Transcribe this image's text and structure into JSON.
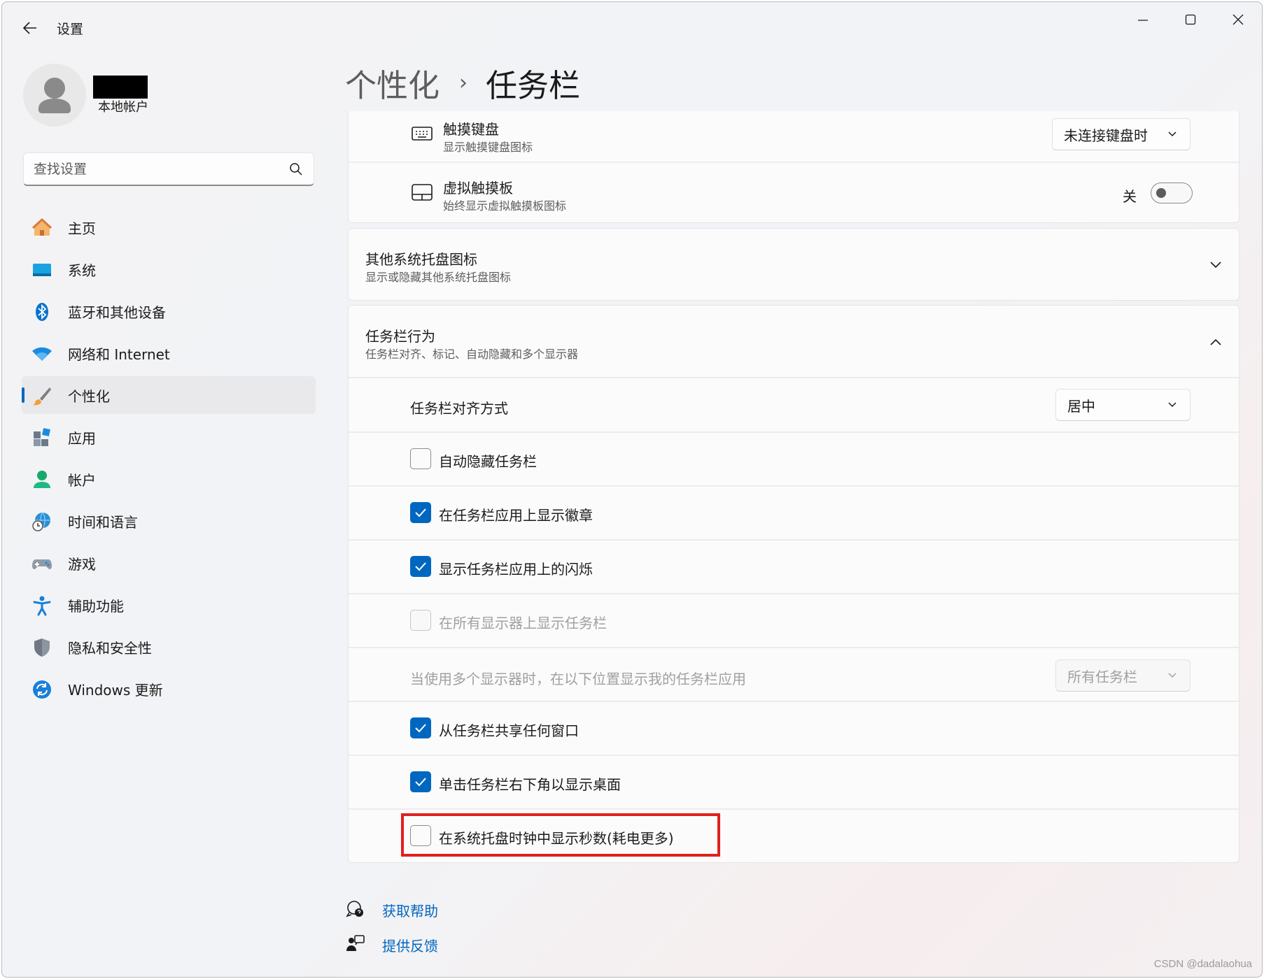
{
  "window": {
    "title": "设置"
  },
  "profile": {
    "account_type": "本地帐户"
  },
  "search": {
    "placeholder": "查找设置"
  },
  "nav": {
    "items": [
      {
        "label": "主页",
        "icon": "home-icon"
      },
      {
        "label": "系统",
        "icon": "system-icon"
      },
      {
        "label": "蓝牙和其他设备",
        "icon": "bluetooth-icon"
      },
      {
        "label": "网络和 Internet",
        "icon": "wifi-icon"
      },
      {
        "label": "个性化",
        "icon": "brush-icon",
        "active": true
      },
      {
        "label": "应用",
        "icon": "apps-icon"
      },
      {
        "label": "帐户",
        "icon": "account-icon"
      },
      {
        "label": "时间和语言",
        "icon": "globe-clock-icon"
      },
      {
        "label": "游戏",
        "icon": "gamepad-icon"
      },
      {
        "label": "辅助功能",
        "icon": "accessibility-icon"
      },
      {
        "label": "隐私和安全性",
        "icon": "shield-icon"
      },
      {
        "label": "Windows 更新",
        "icon": "update-icon"
      }
    ]
  },
  "header": {
    "parent": "个性化",
    "separator": "›",
    "current": "任务栏"
  },
  "tray": {
    "touch_keyboard": {
      "title": "触摸键盘",
      "subtitle": "显示触摸键盘图标",
      "value": "未连接键盘时"
    },
    "virtual_touchpad": {
      "title": "虚拟触摸板",
      "subtitle": "始终显示虚拟触摸板图标",
      "state_label": "关",
      "on": false
    }
  },
  "other_tray": {
    "title": "其他系统托盘图标",
    "subtitle": "显示或隐藏其他系统托盘图标"
  },
  "behaviors": {
    "title": "任务栏行为",
    "subtitle": "任务栏对齐、标记、自动隐藏和多个显示器",
    "alignment": {
      "label": "任务栏对齐方式",
      "value": "居中"
    },
    "options": {
      "auto_hide": {
        "label": "自动隐藏任务栏",
        "checked": false
      },
      "badges": {
        "label": "在任务栏应用上显示徽章",
        "checked": true
      },
      "flashing": {
        "label": "显示任务栏应用上的闪烁",
        "checked": true
      },
      "all_displays": {
        "label": "在所有显示器上显示任务栏",
        "checked": false,
        "disabled": true
      },
      "share_window": {
        "label": "从任务栏共享任何窗口",
        "checked": true
      },
      "show_desktop": {
        "label": "单击任务栏右下角以显示桌面",
        "checked": true
      },
      "show_seconds": {
        "label": "在系统托盘时钟中显示秒数(耗电更多)",
        "checked": false
      }
    },
    "multi_display": {
      "label": "当使用多个显示器时，在以下位置显示我的任务栏应用",
      "value": "所有任务栏",
      "disabled": true
    }
  },
  "footer": {
    "help": "获取帮助",
    "feedback": "提供反馈"
  },
  "watermark": "CSDN @dadalaohua",
  "colors": {
    "accent": "#0067c0",
    "highlight": "#e0201f"
  }
}
